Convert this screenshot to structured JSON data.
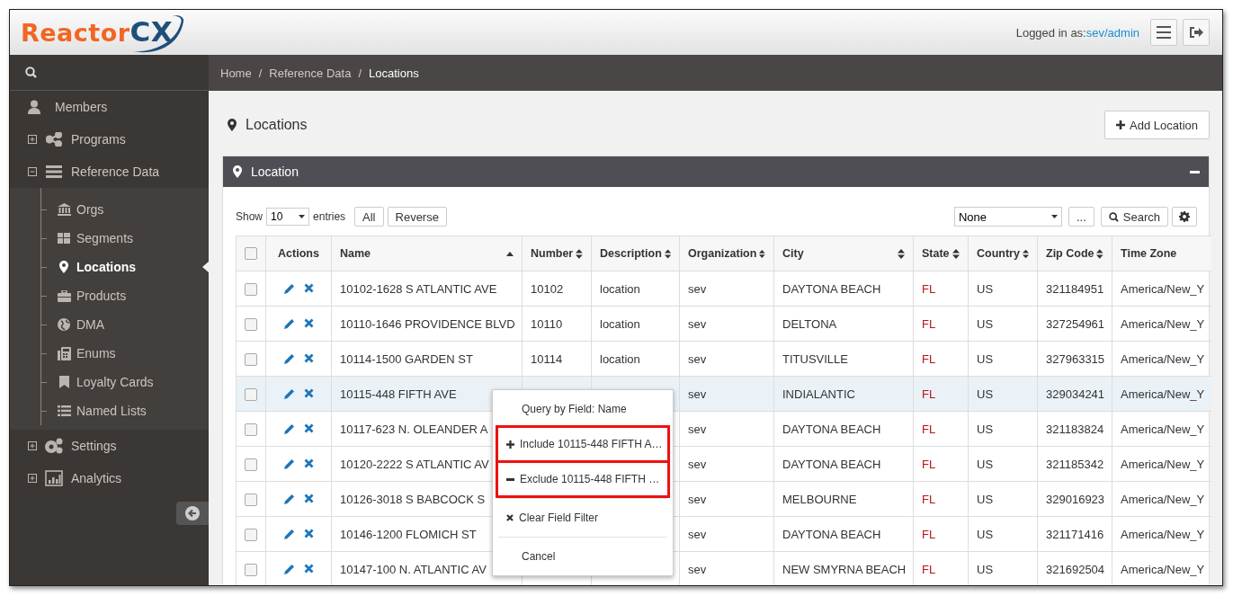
{
  "logo": {
    "main": "Reactor",
    "accent": "CX"
  },
  "header": {
    "login_label": "Logged in as:",
    "login_user": "sev/admin"
  },
  "sidebar": {
    "items": [
      {
        "label": "Members",
        "selected": false
      },
      {
        "label": "Programs",
        "selected": false,
        "expanded": false
      },
      {
        "label": "Reference Data",
        "selected": false,
        "expanded": true,
        "children": [
          {
            "label": "Orgs",
            "selected": false
          },
          {
            "label": "Segments",
            "selected": false
          },
          {
            "label": "Locations",
            "selected": true
          },
          {
            "label": "Products",
            "selected": false
          },
          {
            "label": "DMA",
            "selected": false
          },
          {
            "label": "Enums",
            "selected": false
          },
          {
            "label": "Loyalty Cards",
            "selected": false
          },
          {
            "label": "Named Lists",
            "selected": false
          }
        ]
      },
      {
        "label": "Settings",
        "selected": false,
        "expanded": false
      },
      {
        "label": "Analytics",
        "selected": false,
        "expanded": false
      }
    ]
  },
  "breadcrumb": {
    "separator": "/",
    "items": [
      {
        "label": "Home",
        "current": false
      },
      {
        "label": "Reference Data",
        "current": false
      },
      {
        "label": "Locations",
        "current": true
      }
    ]
  },
  "page_title": "Locations",
  "add_button": "Add Location",
  "panel": {
    "title": "Location",
    "toolbar": {
      "show_label": "Show",
      "page_size": "10",
      "entries_label": "entries",
      "all_button": "All",
      "reverse_button": "Reverse",
      "filter_value": "None",
      "more_button": "...",
      "search_button": "Search"
    },
    "table": {
      "header_checked": false,
      "columns": [
        {
          "label": "Actions",
          "sortable": false
        },
        {
          "label": "Name",
          "sortable": true,
          "sorted_ascending": true
        },
        {
          "label": "Number",
          "sortable": true,
          "sorted_ascending": false
        },
        {
          "label": "Description",
          "sortable": true,
          "sorted_ascending": false
        },
        {
          "label": "Organization",
          "sortable": true,
          "sorted_ascending": false
        },
        {
          "label": "City",
          "sortable": true,
          "sorted_ascending": false
        },
        {
          "label": "State",
          "sortable": true,
          "sorted_ascending": false
        },
        {
          "label": "Country",
          "sortable": true,
          "sorted_ascending": false
        },
        {
          "label": "Zip Code",
          "sortable": true,
          "sorted_ascending": false
        },
        {
          "label": "Time Zone",
          "sortable": false
        }
      ],
      "rows": [
        {
          "checked": false,
          "hovered": false,
          "name": "10102-1628 S ATLANTIC AVE",
          "number": "10102",
          "description": "location",
          "organization": "sev",
          "city": "DAYTONA BEACH",
          "state": "FL",
          "country": "US",
          "zip": "321184951",
          "time_zone": "America/New_Y"
        },
        {
          "checked": false,
          "hovered": false,
          "name": "10110-1646 PROVIDENCE BLVD",
          "number": "10110",
          "description": "location",
          "organization": "sev",
          "city": "DELTONA",
          "state": "FL",
          "country": "US",
          "zip": "327254961",
          "time_zone": "America/New_Y"
        },
        {
          "checked": false,
          "hovered": false,
          "name": "10114-1500 GARDEN ST",
          "number": "10114",
          "description": "location",
          "organization": "sev",
          "city": "TITUSVILLE",
          "state": "FL",
          "country": "US",
          "zip": "327963315",
          "time_zone": "America/New_Y"
        },
        {
          "checked": false,
          "hovered": true,
          "name": "10115-448 FIFTH AVE",
          "organization": "sev",
          "city": "INDIALANTIC",
          "state": "FL",
          "country": "US",
          "zip": "329034241",
          "time_zone": "America/New_Y"
        },
        {
          "checked": false,
          "hovered": false,
          "name": "10117-623 N. OLEANDER A",
          "organization": "sev",
          "city": "DAYTONA BEACH",
          "state": "FL",
          "country": "US",
          "zip": "321183824",
          "time_zone": "America/New_Y"
        },
        {
          "checked": false,
          "hovered": false,
          "name": "10120-2222 S ATLANTIC AV",
          "organization": "sev",
          "city": "DAYTONA BEACH",
          "state": "FL",
          "country": "US",
          "zip": "321185342",
          "time_zone": "America/New_Y"
        },
        {
          "checked": false,
          "hovered": false,
          "name": "10126-3018 S BABCOCK S",
          "organization": "sev",
          "city": "MELBOURNE",
          "state": "FL",
          "country": "US",
          "zip": "329016923",
          "time_zone": "America/New_Y"
        },
        {
          "checked": false,
          "hovered": false,
          "name": "10146-1200 FLOMICH ST",
          "organization": "sev",
          "city": "DAYTONA BEACH",
          "state": "FL",
          "country": "US",
          "zip": "321171416",
          "time_zone": "America/New_Y"
        },
        {
          "checked": false,
          "hovered": false,
          "name": "10147-100 N. ATLANTIC AV",
          "organization": "sev",
          "city": "NEW SMYRNA BEACH",
          "state": "FL",
          "country": "US",
          "zip": "321692504",
          "time_zone": "America/New_Y"
        }
      ]
    }
  },
  "context_menu": {
    "items": [
      {
        "kind": "query",
        "label": "Query by Field: Name",
        "highlighted": false,
        "divider_after": false
      },
      {
        "kind": "include",
        "label": "Include 10115-448 FIFTH A…",
        "highlighted": true,
        "divider_after": false
      },
      {
        "kind": "exclude",
        "label": "Exclude 10115-448 FIFTH …",
        "highlighted": true,
        "divider_after": true
      },
      {
        "kind": "clear",
        "label": "Clear Field Filter",
        "highlighted": false,
        "divider_after": true
      },
      {
        "kind": "cancel",
        "label": "Cancel",
        "highlighted": false,
        "divider_after": false
      }
    ]
  }
}
